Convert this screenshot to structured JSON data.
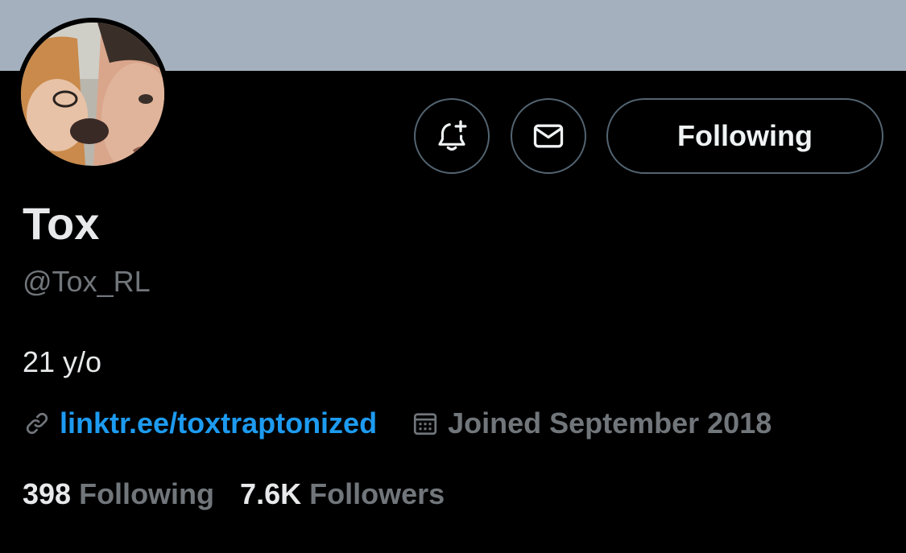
{
  "profile": {
    "display_name": "Tox",
    "handle": "@Tox_RL",
    "bio": "21 y/o",
    "link": "linktr.ee/toxtraptonized",
    "joined": "Joined September 2018"
  },
  "actions": {
    "notify_icon": "bell-plus-icon",
    "message_icon": "envelope-icon",
    "following_label": "Following"
  },
  "stats": {
    "following_count": "398",
    "following_label": "Following",
    "followers_count": "7.6K",
    "followers_label": "Followers"
  },
  "colors": {
    "background": "#000000",
    "banner": "#a4b0bd",
    "text_primary": "#e7e9ea",
    "text_secondary": "#71767b",
    "link": "#1d9bf0",
    "border": "#536471"
  }
}
